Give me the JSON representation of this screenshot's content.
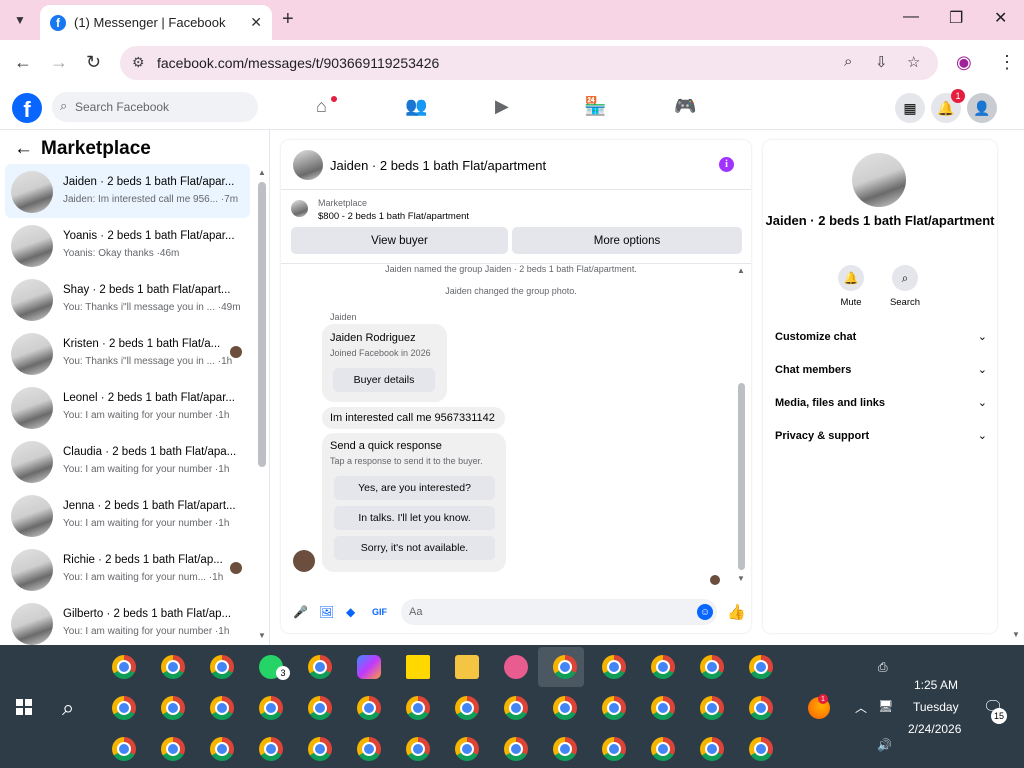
{
  "browser": {
    "tab_title": "(1) Messenger | Facebook",
    "url": "facebook.com/messages/t/903669119253426"
  },
  "facebook": {
    "search_placeholder": "Search Facebook",
    "notification_count": "1"
  },
  "left_panel": {
    "title": "Marketplace",
    "chats": [
      {
        "name": "Jaiden · 2 beds 1 bath Flat/apar...",
        "preview": "Jaiden: Im interested call me 956... ·7m",
        "active": true
      },
      {
        "name": "Yoanis · 2 beds 1 bath Flat/apar...",
        "preview": "Yoanis: Okay thanks ·46m"
      },
      {
        "name": "Shay · 2 beds 1 bath Flat/apart...",
        "preview": "You: Thanks i\"ll message you in ... ·49m"
      },
      {
        "name": "Kristen · 2 beds 1 bath Flat/a...",
        "preview": "You: Thanks i\"ll message you in ... ·1h",
        "seen": true
      },
      {
        "name": "Leonel · 2 beds 1 bath Flat/apar...",
        "preview": "You: I am waiting for your number ·1h"
      },
      {
        "name": "Claudia · 2 beds 1 bath Flat/apa...",
        "preview": "You: I am waiting for your number ·1h"
      },
      {
        "name": "Jenna · 2 beds 1 bath Flat/apart...",
        "preview": "You: I am waiting for your number ·1h"
      },
      {
        "name": "Richie · 2 beds 1 bath Flat/ap...",
        "preview": "You: I am waiting for your num... ·1h",
        "seen": true
      },
      {
        "name": "Gilberto · 2 beds 1 bath Flat/ap...",
        "preview": "You: I am waiting for your number ·1h"
      }
    ]
  },
  "conversation": {
    "title": "Jaiden · 2 beds 1 bath Flat/apartment",
    "marketplace_label": "Marketplace",
    "listing": "$800 - 2 beds 1 bath Flat/apartment",
    "view_buyer": "View buyer",
    "more_options": "More options",
    "system_messages": [
      "Jaiden named the group Jaiden · 2 beds 1 bath Flat/apartment.",
      "Jaiden changed the group photo."
    ],
    "sender": "Jaiden",
    "buyer_card": {
      "name": "Jaiden Rodriguez",
      "joined": "Joined Facebook in 2026",
      "button": "Buyer details"
    },
    "message": "Im interested call me 9567331142",
    "quick_response": {
      "title": "Send a quick response",
      "subtitle": "Tap a response to send it to the buyer.",
      "options": [
        "Yes, are you interested?",
        "In talks. I'll let you know.",
        "Sorry, it's not available."
      ]
    },
    "composer_placeholder": "Aa"
  },
  "right_panel": {
    "name": "Jaiden · 2 beds 1 bath Flat/apartment",
    "mute": "Mute",
    "search": "Search",
    "sections": [
      "Customize chat",
      "Chat members",
      "Media, files and links",
      "Privacy & support"
    ]
  },
  "taskbar": {
    "whatsapp_badge": "3",
    "weather_badge": "1",
    "time": "1:25 AM",
    "day": "Tuesday",
    "date": "2/24/2026",
    "notifications": "15"
  }
}
